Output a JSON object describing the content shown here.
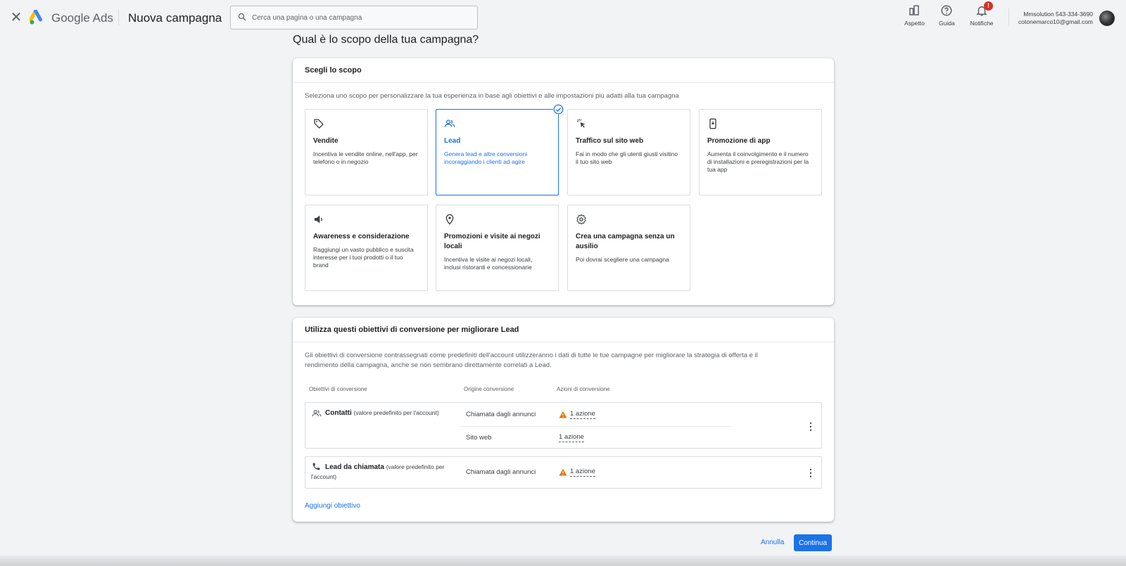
{
  "header": {
    "brand_google": "Google",
    "brand_ads": "Ads",
    "page_title": "Nuova campagna",
    "search_placeholder": "Cerca una pagina o una campagna",
    "tools": {
      "appearance": "Aspetto",
      "help": "Guida",
      "notifications": "Notifiche",
      "notifications_badge": "!"
    },
    "account": {
      "name": "Mmsolution 543-334-3690",
      "email": "cotonemarco10@gmail.com"
    }
  },
  "question": "Qual è lo scopo della tua campagna?",
  "goal_section": {
    "title": "Scegli lo scopo",
    "description": "Seleziona uno scopo per personalizzare la tua esperienza in base agli obiettivi e alle impostazioni più adatti alla tua campagna",
    "goals": [
      {
        "title": "Vendite",
        "desc": "Incentiva le vendite online, nell'app, per telefono o in negozio",
        "icon": "tag-icon",
        "selected": false
      },
      {
        "title": "Lead",
        "desc": "Genera lead e altre conversioni incoraggiando i clienti ad agire",
        "icon": "people-icon",
        "selected": true
      },
      {
        "title": "Traffico sul sito web",
        "desc": "Fai in modo che gli utenti giusti visitino il tuo sito web",
        "icon": "cursor-click-icon",
        "selected": false
      },
      {
        "title": "Promozione di app",
        "desc": "Aumenta il coinvolgimento e il numero di installazioni e preregistrazioni per la tua app",
        "icon": "phone-icon",
        "selected": false
      },
      {
        "title": "Awareness e considerazione",
        "desc": "Raggiungi un vasto pubblico e suscita interesse per i tuoi prodotti o il tuo brand",
        "icon": "megaphone-icon",
        "selected": false
      },
      {
        "title": "Promozioni e visite ai negozi locali",
        "desc": "Incentiva le visite ai negozi locali, inclusi ristoranti e concessionarie",
        "icon": "location-pin-icon",
        "selected": false
      },
      {
        "title": "Crea una campagna senza un ausilio",
        "desc": "Poi dovrai scegliere una campagna",
        "icon": "gear-icon",
        "selected": false
      }
    ]
  },
  "conversion_section": {
    "title": "Utilizza questi obiettivi di conversione per migliorare Lead",
    "description_line1": "Gli obiettivi di conversione contrassegnati come predefiniti dell'account utilizzeranno i dati di tutte le tue campagne per migliorare la strategia di offerta e il",
    "description_line2": "rendimento della campagna, anche se non sembrano direttamente correlati a Lead.",
    "columns": [
      "Obiettivi di conversione",
      "Origine conversione",
      "Azioni di conversione"
    ],
    "rows": [
      {
        "name": "Contatti",
        "note": "(valore predefinito per l'account)",
        "sources": [
          {
            "origin": "Chiamata dagli annunci",
            "actions": "1 azione",
            "warning": true
          },
          {
            "origin": "Sito web",
            "actions": "1 azione",
            "warning": false
          }
        ]
      },
      {
        "name": "Lead da chiamata",
        "note_line1": "(valore predefinito per",
        "note_line2": "l'account)",
        "sources": [
          {
            "origin": "Chiamata dagli annunci",
            "actions": "1 azione",
            "warning": true
          }
        ]
      }
    ],
    "add_goal": "Aggiungi obiettivo"
  },
  "footer": {
    "cancel": "Annulla",
    "continue": "Continua"
  },
  "colors": {
    "accent": "#1a73e8",
    "warning": "#e37400",
    "notification": "#d93025"
  }
}
